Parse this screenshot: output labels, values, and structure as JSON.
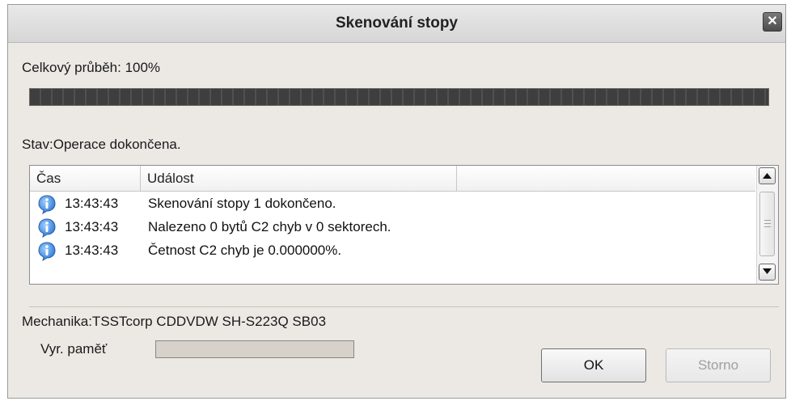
{
  "window": {
    "title": "Skenování stopy",
    "close_glyph": "✕"
  },
  "progress": {
    "label": "Celkový průběh: 100%",
    "value_percent": 100
  },
  "status": {
    "text": "Stav:Operace dokončena."
  },
  "log": {
    "columns": [
      "Čas",
      "Událost",
      ""
    ],
    "rows": [
      {
        "icon": "info-icon",
        "time": "13:43:43",
        "event": "Skenování stopy 1 dokončeno."
      },
      {
        "icon": "info-icon",
        "time": "13:43:43",
        "event": "Nalezeno 0 bytů C2 chyb v 0 sektorech."
      },
      {
        "icon": "info-icon",
        "time": "13:43:43",
        "event": "Četnost C2 chyb je 0.000000%."
      }
    ]
  },
  "drive": {
    "label": "Mechanika:TSSTcorp CDDVDW SH-S223Q SB03"
  },
  "buffer": {
    "label": "Vyr. paměť",
    "value_percent": 0
  },
  "buttons": {
    "ok": "OK",
    "cancel": "Storno"
  },
  "colors": {
    "progress_fill": "#404040",
    "info_blue": "#2f78d6",
    "dialog_bg": "#ece9e5"
  }
}
